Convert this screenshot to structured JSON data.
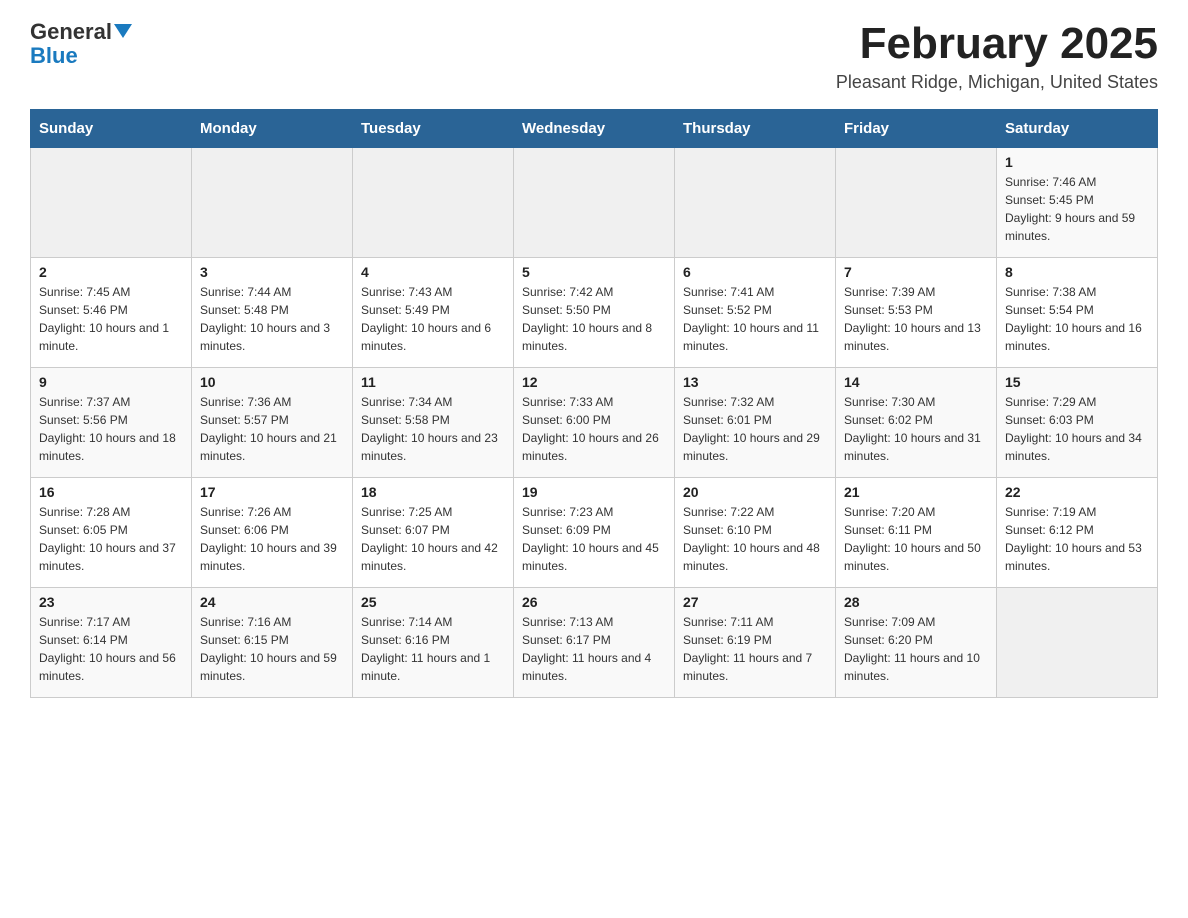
{
  "header": {
    "logo": {
      "text_general": "General",
      "text_blue": "Blue"
    },
    "title": "February 2025",
    "location": "Pleasant Ridge, Michigan, United States"
  },
  "days_of_week": [
    "Sunday",
    "Monday",
    "Tuesday",
    "Wednesday",
    "Thursday",
    "Friday",
    "Saturday"
  ],
  "weeks": [
    [
      {
        "day": "",
        "info": ""
      },
      {
        "day": "",
        "info": ""
      },
      {
        "day": "",
        "info": ""
      },
      {
        "day": "",
        "info": ""
      },
      {
        "day": "",
        "info": ""
      },
      {
        "day": "",
        "info": ""
      },
      {
        "day": "1",
        "info": "Sunrise: 7:46 AM\nSunset: 5:45 PM\nDaylight: 9 hours and 59 minutes."
      }
    ],
    [
      {
        "day": "2",
        "info": "Sunrise: 7:45 AM\nSunset: 5:46 PM\nDaylight: 10 hours and 1 minute."
      },
      {
        "day": "3",
        "info": "Sunrise: 7:44 AM\nSunset: 5:48 PM\nDaylight: 10 hours and 3 minutes."
      },
      {
        "day": "4",
        "info": "Sunrise: 7:43 AM\nSunset: 5:49 PM\nDaylight: 10 hours and 6 minutes."
      },
      {
        "day": "5",
        "info": "Sunrise: 7:42 AM\nSunset: 5:50 PM\nDaylight: 10 hours and 8 minutes."
      },
      {
        "day": "6",
        "info": "Sunrise: 7:41 AM\nSunset: 5:52 PM\nDaylight: 10 hours and 11 minutes."
      },
      {
        "day": "7",
        "info": "Sunrise: 7:39 AM\nSunset: 5:53 PM\nDaylight: 10 hours and 13 minutes."
      },
      {
        "day": "8",
        "info": "Sunrise: 7:38 AM\nSunset: 5:54 PM\nDaylight: 10 hours and 16 minutes."
      }
    ],
    [
      {
        "day": "9",
        "info": "Sunrise: 7:37 AM\nSunset: 5:56 PM\nDaylight: 10 hours and 18 minutes."
      },
      {
        "day": "10",
        "info": "Sunrise: 7:36 AM\nSunset: 5:57 PM\nDaylight: 10 hours and 21 minutes."
      },
      {
        "day": "11",
        "info": "Sunrise: 7:34 AM\nSunset: 5:58 PM\nDaylight: 10 hours and 23 minutes."
      },
      {
        "day": "12",
        "info": "Sunrise: 7:33 AM\nSunset: 6:00 PM\nDaylight: 10 hours and 26 minutes."
      },
      {
        "day": "13",
        "info": "Sunrise: 7:32 AM\nSunset: 6:01 PM\nDaylight: 10 hours and 29 minutes."
      },
      {
        "day": "14",
        "info": "Sunrise: 7:30 AM\nSunset: 6:02 PM\nDaylight: 10 hours and 31 minutes."
      },
      {
        "day": "15",
        "info": "Sunrise: 7:29 AM\nSunset: 6:03 PM\nDaylight: 10 hours and 34 minutes."
      }
    ],
    [
      {
        "day": "16",
        "info": "Sunrise: 7:28 AM\nSunset: 6:05 PM\nDaylight: 10 hours and 37 minutes."
      },
      {
        "day": "17",
        "info": "Sunrise: 7:26 AM\nSunset: 6:06 PM\nDaylight: 10 hours and 39 minutes."
      },
      {
        "day": "18",
        "info": "Sunrise: 7:25 AM\nSunset: 6:07 PM\nDaylight: 10 hours and 42 minutes."
      },
      {
        "day": "19",
        "info": "Sunrise: 7:23 AM\nSunset: 6:09 PM\nDaylight: 10 hours and 45 minutes."
      },
      {
        "day": "20",
        "info": "Sunrise: 7:22 AM\nSunset: 6:10 PM\nDaylight: 10 hours and 48 minutes."
      },
      {
        "day": "21",
        "info": "Sunrise: 7:20 AM\nSunset: 6:11 PM\nDaylight: 10 hours and 50 minutes."
      },
      {
        "day": "22",
        "info": "Sunrise: 7:19 AM\nSunset: 6:12 PM\nDaylight: 10 hours and 53 minutes."
      }
    ],
    [
      {
        "day": "23",
        "info": "Sunrise: 7:17 AM\nSunset: 6:14 PM\nDaylight: 10 hours and 56 minutes."
      },
      {
        "day": "24",
        "info": "Sunrise: 7:16 AM\nSunset: 6:15 PM\nDaylight: 10 hours and 59 minutes."
      },
      {
        "day": "25",
        "info": "Sunrise: 7:14 AM\nSunset: 6:16 PM\nDaylight: 11 hours and 1 minute."
      },
      {
        "day": "26",
        "info": "Sunrise: 7:13 AM\nSunset: 6:17 PM\nDaylight: 11 hours and 4 minutes."
      },
      {
        "day": "27",
        "info": "Sunrise: 7:11 AM\nSunset: 6:19 PM\nDaylight: 11 hours and 7 minutes."
      },
      {
        "day": "28",
        "info": "Sunrise: 7:09 AM\nSunset: 6:20 PM\nDaylight: 11 hours and 10 minutes."
      },
      {
        "day": "",
        "info": ""
      }
    ]
  ]
}
